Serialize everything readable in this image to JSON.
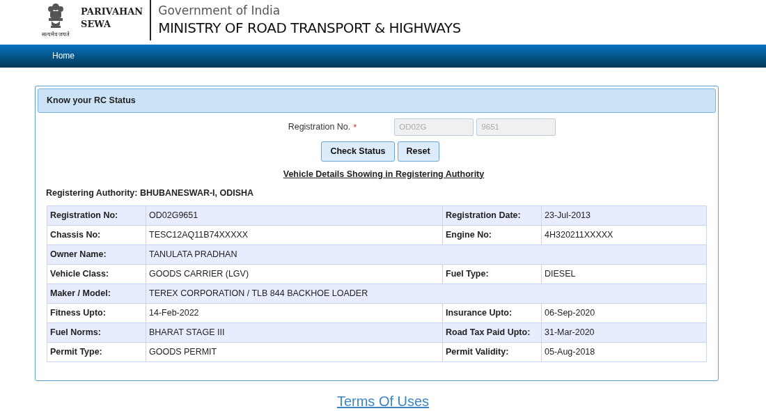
{
  "brand": {
    "motto": "सत्यमेव जयते",
    "name_line_1": "PARIVAHAN",
    "name_line_2": "SEWA",
    "subtitle": "Government of India",
    "title": "MINISTRY OF ROAD TRANSPORT & HIGHWAYS"
  },
  "nav": [
    {
      "label": "Home"
    }
  ],
  "panel": {
    "heading": "Know your RC Status",
    "form": {
      "label": "Registration No.",
      "required_mark": "*",
      "fields": [
        {
          "value": "OD02G",
          "disabled": true
        },
        {
          "value": "9651",
          "disabled": true
        }
      ],
      "buttons": [
        "Check Status",
        "Reset"
      ]
    },
    "details_link": "Vehicle Details Showing in Registering Authority",
    "authority": "Registering Authority: BHUBANESWAR-I, ODISHA",
    "rows": [
      {
        "label_1": "Registration No:",
        "value_1": "OD02G9651",
        "label_2": "Registration Date:",
        "value_2": "23-Jul-2013"
      },
      {
        "label_1": "Chassis No:",
        "value_1": "TESC12AQ11B74XXXXX",
        "label_2": "Engine No:",
        "value_2": "4H320211XXXXX"
      },
      {
        "label_1": "Owner Name:",
        "value_1": "TANULATA PRADHAN"
      },
      {
        "label_1": "Vehicle Class:",
        "value_1": "GOODS CARRIER (LGV)",
        "label_2": "Fuel Type:",
        "value_2": "DIESEL"
      },
      {
        "label_1": "Maker / Model:",
        "value_1": "TEREX CORPORATION / TLB 844 BACKHOE LOADER"
      },
      {
        "label_1": "Fitness Upto:",
        "value_1": "14-Feb-2022",
        "label_2": "Insurance Upto:",
        "value_2": "06-Sep-2020"
      },
      {
        "label_1": "Fuel Norms:",
        "value_1": "BHARAT STAGE III",
        "label_2": "Road Tax Paid Upto:",
        "value_2": "31-Mar-2020"
      },
      {
        "label_1": "Permit Type:",
        "value_1": "GOODS PERMIT",
        "label_2": "Permit Validity:",
        "value_2": "05-Aug-2018"
      }
    ]
  },
  "footer_link": "Terms Of Uses"
}
